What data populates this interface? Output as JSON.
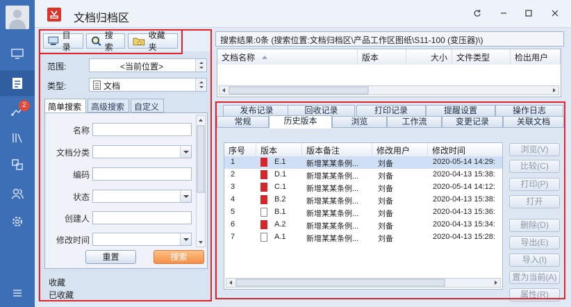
{
  "window": {
    "title": "文档归档区"
  },
  "rail": {
    "badge_count": "2"
  },
  "left": {
    "tabs": [
      "目录",
      "搜索",
      "收藏夹"
    ],
    "scope_label": "范围:",
    "scope_value": "<当前位置>",
    "type_label": "类型:",
    "type_value": "文档",
    "subtabs": [
      "简单搜索",
      "高级搜索",
      "自定义"
    ],
    "fields": {
      "name": "名称",
      "category": "文档分类",
      "code": "编码",
      "status": "状态",
      "creator": "创建人",
      "modified_time": "修改时间"
    },
    "reset_label": "重置",
    "search_label": "搜索",
    "fav_items": [
      "收藏",
      "已收藏"
    ]
  },
  "results": {
    "header": "搜索结果:0条 (搜索位置:文档归档区\\产品工作区图纸\\S11-100 (变压器)\\)",
    "columns": [
      "文档名称",
      "版本",
      "大小",
      "文件类型",
      "检出用户"
    ]
  },
  "detail": {
    "tabs_row1": [
      "发布记录",
      "回收记录",
      "打印记录",
      "提醒设置",
      "操作日志"
    ],
    "tabs_row2": [
      "常规",
      "历史版本",
      "浏览",
      "工作流",
      "变更记录",
      "关联文档"
    ],
    "history": {
      "columns": [
        "序号",
        "版本",
        "版本备注",
        "修改用户",
        "修改时间"
      ],
      "rows": [
        {
          "no": "1",
          "version": "E.1",
          "note": "新增某某条例...",
          "user": "刘备",
          "time": "2020-05-14 14:29:",
          "icon": "red"
        },
        {
          "no": "2",
          "version": "D.1",
          "note": "新增某某条例...",
          "user": "刘备",
          "time": "2020-04-13 15:38:",
          "icon": "red"
        },
        {
          "no": "3",
          "version": "C.1",
          "note": "新增某某条例...",
          "user": "刘备",
          "time": "2020-05-14 14:12:",
          "icon": "red"
        },
        {
          "no": "4",
          "version": "B.2",
          "note": "新增某某条例...",
          "user": "刘备",
          "time": "2020-04-13 15:38:",
          "icon": "red"
        },
        {
          "no": "5",
          "version": "B.1",
          "note": "新增某某条例...",
          "user": "刘备",
          "time": "2020-04-13 15:36:",
          "icon": "gray"
        },
        {
          "no": "6",
          "version": "A.2",
          "note": "新增某某条例...",
          "user": "刘备",
          "time": "2020-04-13 15:34:",
          "icon": "red"
        },
        {
          "no": "7",
          "version": "A.1",
          "note": "新增某某条例...",
          "user": "刘备",
          "time": "2020-04-13 15:28:",
          "icon": "gray"
        }
      ]
    },
    "actions": [
      "浏览(V)",
      "比较(C)",
      "打印(P)",
      "打开",
      "删除(D)",
      "导出(E)",
      "导入(I)",
      "置为当前(A)",
      "属性(R)"
    ]
  }
}
